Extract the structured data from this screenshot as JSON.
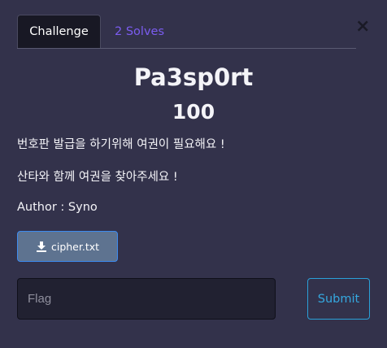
{
  "tabs": {
    "challenge": "Challenge",
    "solves": "2 Solves"
  },
  "close_icon": "close-icon",
  "challenge": {
    "name": "Pa3sp0rt",
    "points": "100",
    "description_lines": [
      "번호판 발급을 하기위해 여권이 필요해요 !",
      "산타와 함께 여권을 찾아주세요 !",
      "Author : Syno"
    ]
  },
  "file": {
    "icon": "download-icon",
    "label": "cipher.txt"
  },
  "flag": {
    "placeholder": "Flag",
    "value": ""
  },
  "submit_label": "Submit",
  "colors": {
    "background": "#33324b",
    "accent_purple": "#7b5cf0",
    "download_button": "#5e7390",
    "submit_border": "#2aa0d8"
  }
}
